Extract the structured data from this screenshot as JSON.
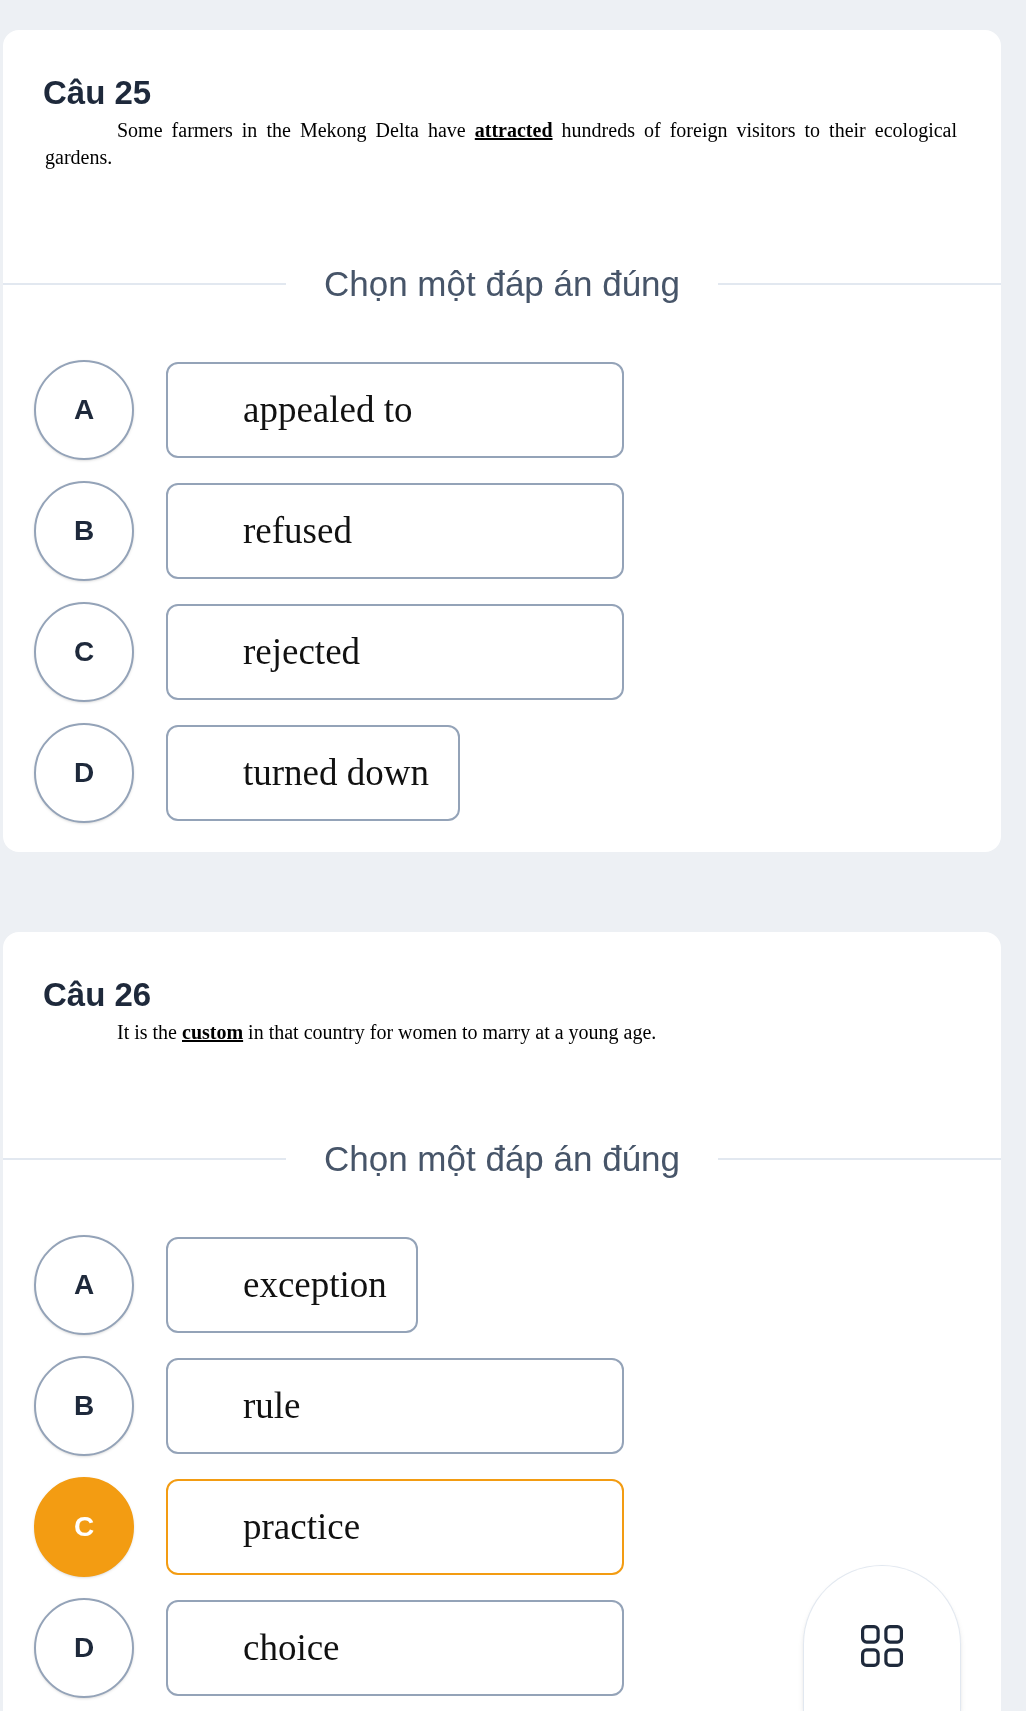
{
  "questions": [
    {
      "title": "Câu 25",
      "text": "Some farmers in the Mekong Delta have **attracted** hundreds of foreign visitors to their ecological gardens.",
      "prompt": "Chọn một đáp án đúng",
      "options": [
        {
          "letter": "A",
          "text": "appealed to",
          "kind": "wide",
          "selected": false
        },
        {
          "letter": "B",
          "text": "refused",
          "kind": "wide",
          "selected": false
        },
        {
          "letter": "C",
          "text": "rejected",
          "kind": "wide",
          "selected": false
        },
        {
          "letter": "D",
          "text": "turned down",
          "kind": "fit",
          "selected": false
        }
      ]
    },
    {
      "title": "Câu 26",
      "text": "It is the **custom** in that country for women to marry at a young age.",
      "prompt": "Chọn một đáp án đúng",
      "options": [
        {
          "letter": "A",
          "text": "exception",
          "kind": "fit",
          "selected": false
        },
        {
          "letter": "B",
          "text": "rule",
          "kind": "wide",
          "selected": false
        },
        {
          "letter": "C",
          "text": "practice",
          "kind": "wide",
          "selected": true
        },
        {
          "letter": "D",
          "text": "choice",
          "kind": "wide",
          "selected": false
        }
      ]
    }
  ]
}
